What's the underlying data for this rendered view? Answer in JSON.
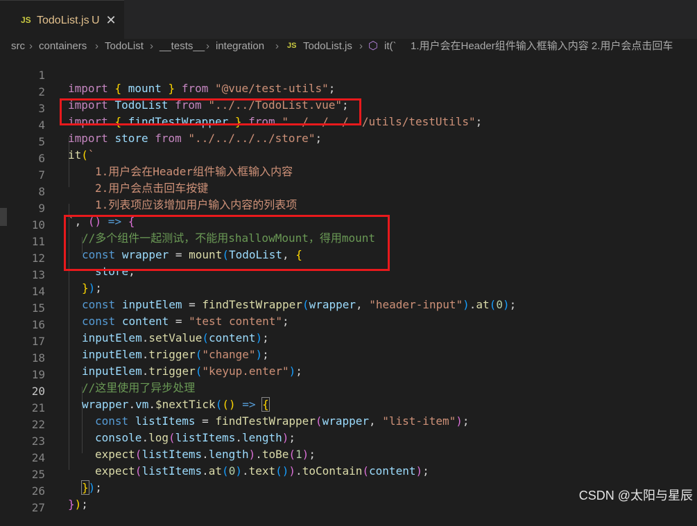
{
  "tab": {
    "icon": "JS",
    "filename": "TodoList.js",
    "modified": "U",
    "close": "✕"
  },
  "breadcrumb": {
    "items": [
      "src",
      "containers",
      "TodoList",
      "__tests__",
      "integration"
    ],
    "file_icon": "JS",
    "file": "TodoList.js",
    "symbol_icon": "cube-icon",
    "symbol": "it(`",
    "symbol_text": "1.用户会在Header组件输入框输入内容 2.用户会点击回车"
  },
  "line_numbers": [
    "1",
    "2",
    "3",
    "4",
    "5",
    "6",
    "7",
    "8",
    "9",
    "10",
    "11",
    "12",
    "13",
    "14",
    "15",
    "16",
    "17",
    "18",
    "19",
    "20",
    "21",
    "22",
    "23",
    "24",
    "25",
    "26",
    "27"
  ],
  "active_line": "20",
  "code": {
    "l1": [
      "import",
      "{",
      "mount",
      "}",
      "from",
      "\"@vue/test-utils\"",
      ";"
    ],
    "l2": [
      "import",
      "TodoList",
      "from",
      "\"../../TodoList.vue\"",
      ";"
    ],
    "l3": [
      "import",
      "{",
      "findTestWrapper",
      "}",
      "from",
      "\"../../../../utils/testUtils\"",
      ";"
    ],
    "l4": [
      "import",
      "store",
      "from",
      "\"../../../../store\"",
      ";"
    ],
    "l5": [
      "it",
      "("
    ],
    "l6": "1.用户会在Header组件输入框输入内容",
    "l7": "2.用户会点击回车按键",
    "l8": "1.列表项应该增加用户输入内容的列表项",
    "l9": [
      "`",
      ", ",
      "()",
      " => ",
      "{"
    ],
    "l10": "//多个组件一起测试，不能用shallowMount，得用mount",
    "l11": [
      "const",
      "wrapper",
      " = ",
      "mount",
      "(",
      "TodoList",
      ", ",
      "{"
    ],
    "l12": [
      "store",
      ","
    ],
    "l13": [
      "}",
      ")",
      ";"
    ],
    "l14": [
      "const",
      "inputElem",
      " = ",
      "findTestWrapper",
      "(",
      "wrapper",
      ", ",
      "\"header-input\"",
      ")",
      ".",
      "at",
      "(",
      "0",
      ")",
      ";"
    ],
    "l15": [
      "const",
      "content",
      " = ",
      "\"test content\"",
      ";"
    ],
    "l16": [
      "inputElem",
      ".",
      "setValue",
      "(",
      "content",
      ")",
      ";"
    ],
    "l17": [
      "inputElem",
      ".",
      "trigger",
      "(",
      "\"change\"",
      ")",
      ";"
    ],
    "l18": [
      "inputElem",
      ".",
      "trigger",
      "(",
      "\"keyup.enter\"",
      ")",
      ";"
    ],
    "l19": "//这里使用了异步处理",
    "l20": [
      "wrapper",
      ".",
      "vm",
      ".",
      "$nextTick",
      "(",
      "()",
      " => ",
      "{"
    ],
    "l21": [
      "const",
      "listItems",
      " = ",
      "findTestWrapper",
      "(",
      "wrapper",
      ", ",
      "\"list-item\"",
      ")",
      ";"
    ],
    "l22": [
      "console",
      ".",
      "log",
      "(",
      "listItems",
      ".",
      "length",
      ")",
      ";"
    ],
    "l23": [
      "expect",
      "(",
      "listItems",
      ".",
      "length",
      ")",
      ".",
      "toBe",
      "(",
      "1",
      ")",
      ";"
    ],
    "l24": [
      "expect",
      "(",
      "listItems",
      ".",
      "at",
      "(",
      "0",
      ")",
      ".",
      "text",
      "()",
      ")",
      ".",
      "toContain",
      "(",
      "content",
      ")",
      ";"
    ],
    "l25": [
      "}",
      ")",
      ";"
    ],
    "l26": [
      "}",
      ")",
      ";"
    ]
  },
  "watermark": "CSDN @太阳与星辰",
  "colors": {
    "highlight_box": "#e8191c",
    "background": "#1e1e1e"
  }
}
